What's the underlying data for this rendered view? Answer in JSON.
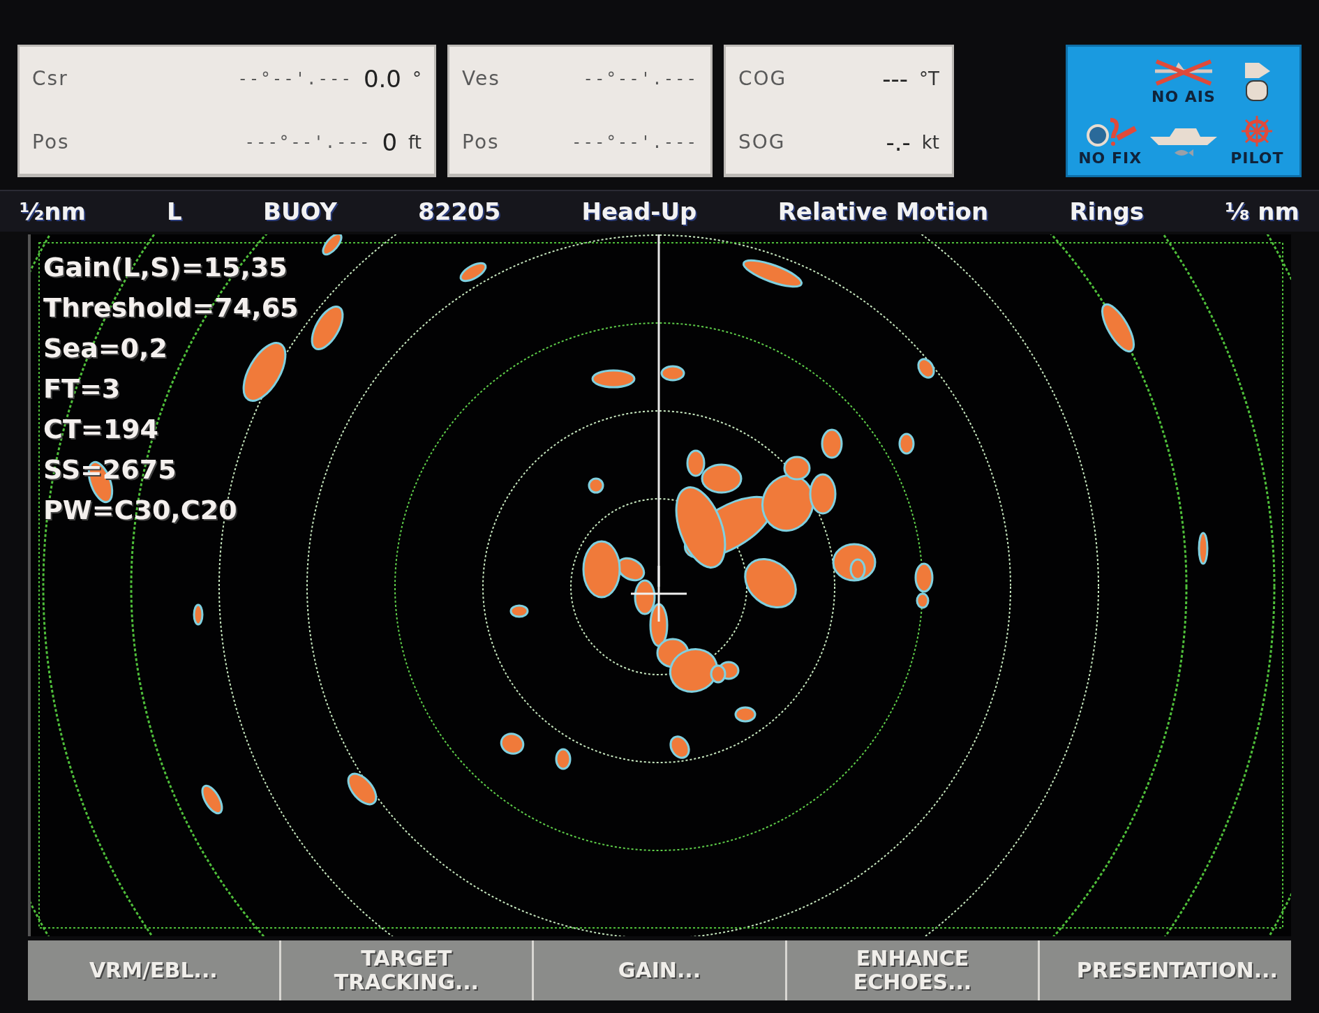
{
  "info_panels": [
    {
      "rows": [
        {
          "label": "Csr",
          "position": "--°--'.---",
          "value": "0.0",
          "unit": "°"
        },
        {
          "label": "Pos",
          "position": "---°--'.---",
          "value": "0",
          "unit": "ft"
        }
      ]
    },
    {
      "rows": [
        {
          "label": "Ves",
          "position": "--°--'.---"
        },
        {
          "label": "Pos",
          "position": "---°--'.---"
        }
      ]
    },
    {
      "rows": [
        {
          "label": "COG",
          "value": "---",
          "unit": "°T"
        },
        {
          "label": "SOG",
          "value": "-.-",
          "unit": "kt"
        }
      ]
    }
  ],
  "status_panel": {
    "no_fix": "NO FIX",
    "no_ais": "NO AIS",
    "pilot": "PILOT"
  },
  "header_items": [
    "½nm",
    "L",
    "BUOY",
    "82205",
    "Head-Up",
    "Relative Motion",
    "Rings",
    "⅛ nm"
  ],
  "radar_readouts": [
    "Gain(L,S)=15,35",
    "Threshold=74,65",
    "Sea=0,2",
    "FT=3",
    "CT=194",
    "SS=2675",
    "PW=C30,C20"
  ],
  "softkeys": [
    "VRM/EBL...",
    "TARGET TRACKING...",
    "GAIN...",
    "ENHANCE ECHOES...",
    "PRESENTATION..."
  ]
}
